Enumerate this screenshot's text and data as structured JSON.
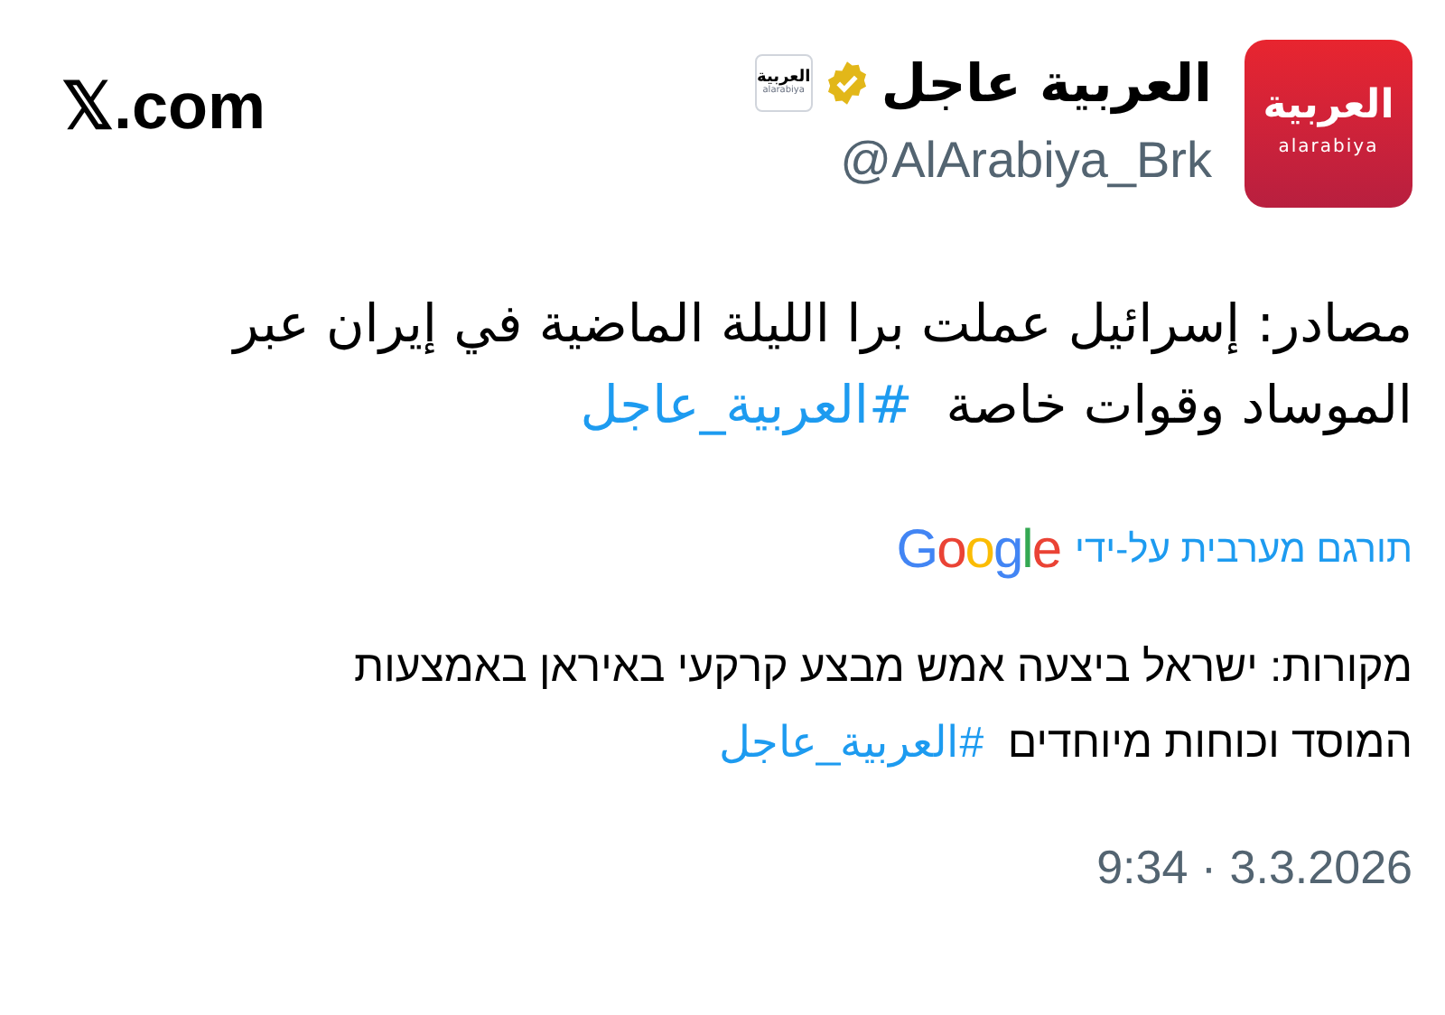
{
  "site": "𝕏.com",
  "account": {
    "name": "العربية عاجل",
    "handle": "@AlArabiya_Brk",
    "verified": true,
    "logo_arabic": "العربية",
    "logo_latin": "alarabiya",
    "badge_arabic": "العربية",
    "badge_latin": "alarabiya"
  },
  "tweet": {
    "lines": [
      "مصادر: إسرائيل عملت برا الليلة الماضية في إيران عبر",
      "الموساد وقوات خاصة"
    ],
    "hashtag": "#العربية_عاجل"
  },
  "translation": {
    "label": "תורגם מערבית על-ידי",
    "provider": "Google",
    "lines": [
      "מקורות: ישראל ביצעה אמש מבצע קרקעי באיראן באמצעות",
      "המוסד וכוחות מיוחדים"
    ],
    "hashtag": "#العربية_عاجل"
  },
  "timestamp": "9:34 · 3.3.2026"
}
